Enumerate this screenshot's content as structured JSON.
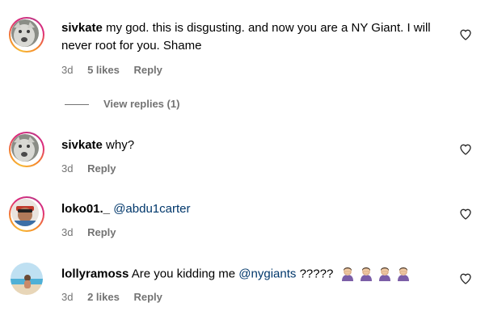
{
  "comments": [
    {
      "username": "sivkate",
      "text": "my god. this is disgusting. and now you are a NY Giant. I will never root for you. Shame",
      "time": "3d",
      "likes": "5 likes",
      "reply": "Reply",
      "has_story_ring": true
    },
    {
      "view_replies": "View replies (1)"
    },
    {
      "username": "sivkate",
      "text": "why?",
      "time": "3d",
      "reply": "Reply",
      "has_story_ring": true
    },
    {
      "username": "loko01._",
      "mention": "@abdu1carter",
      "time": "3d",
      "reply": "Reply",
      "has_story_ring": true
    },
    {
      "username": "lollyramoss",
      "text_before": "Are you kidding me",
      "mention": "@nygiants",
      "text_after": "?????",
      "emoji_name": "person-facepalming-emoji",
      "emoji_count": 4,
      "time": "3d",
      "likes": "2 likes",
      "reply": "Reply",
      "has_story_ring": false
    }
  ],
  "colors": {
    "mention": "#00376b",
    "meta": "#737373",
    "ring_start": "#f58529",
    "ring_end": "#dd2a7b"
  }
}
